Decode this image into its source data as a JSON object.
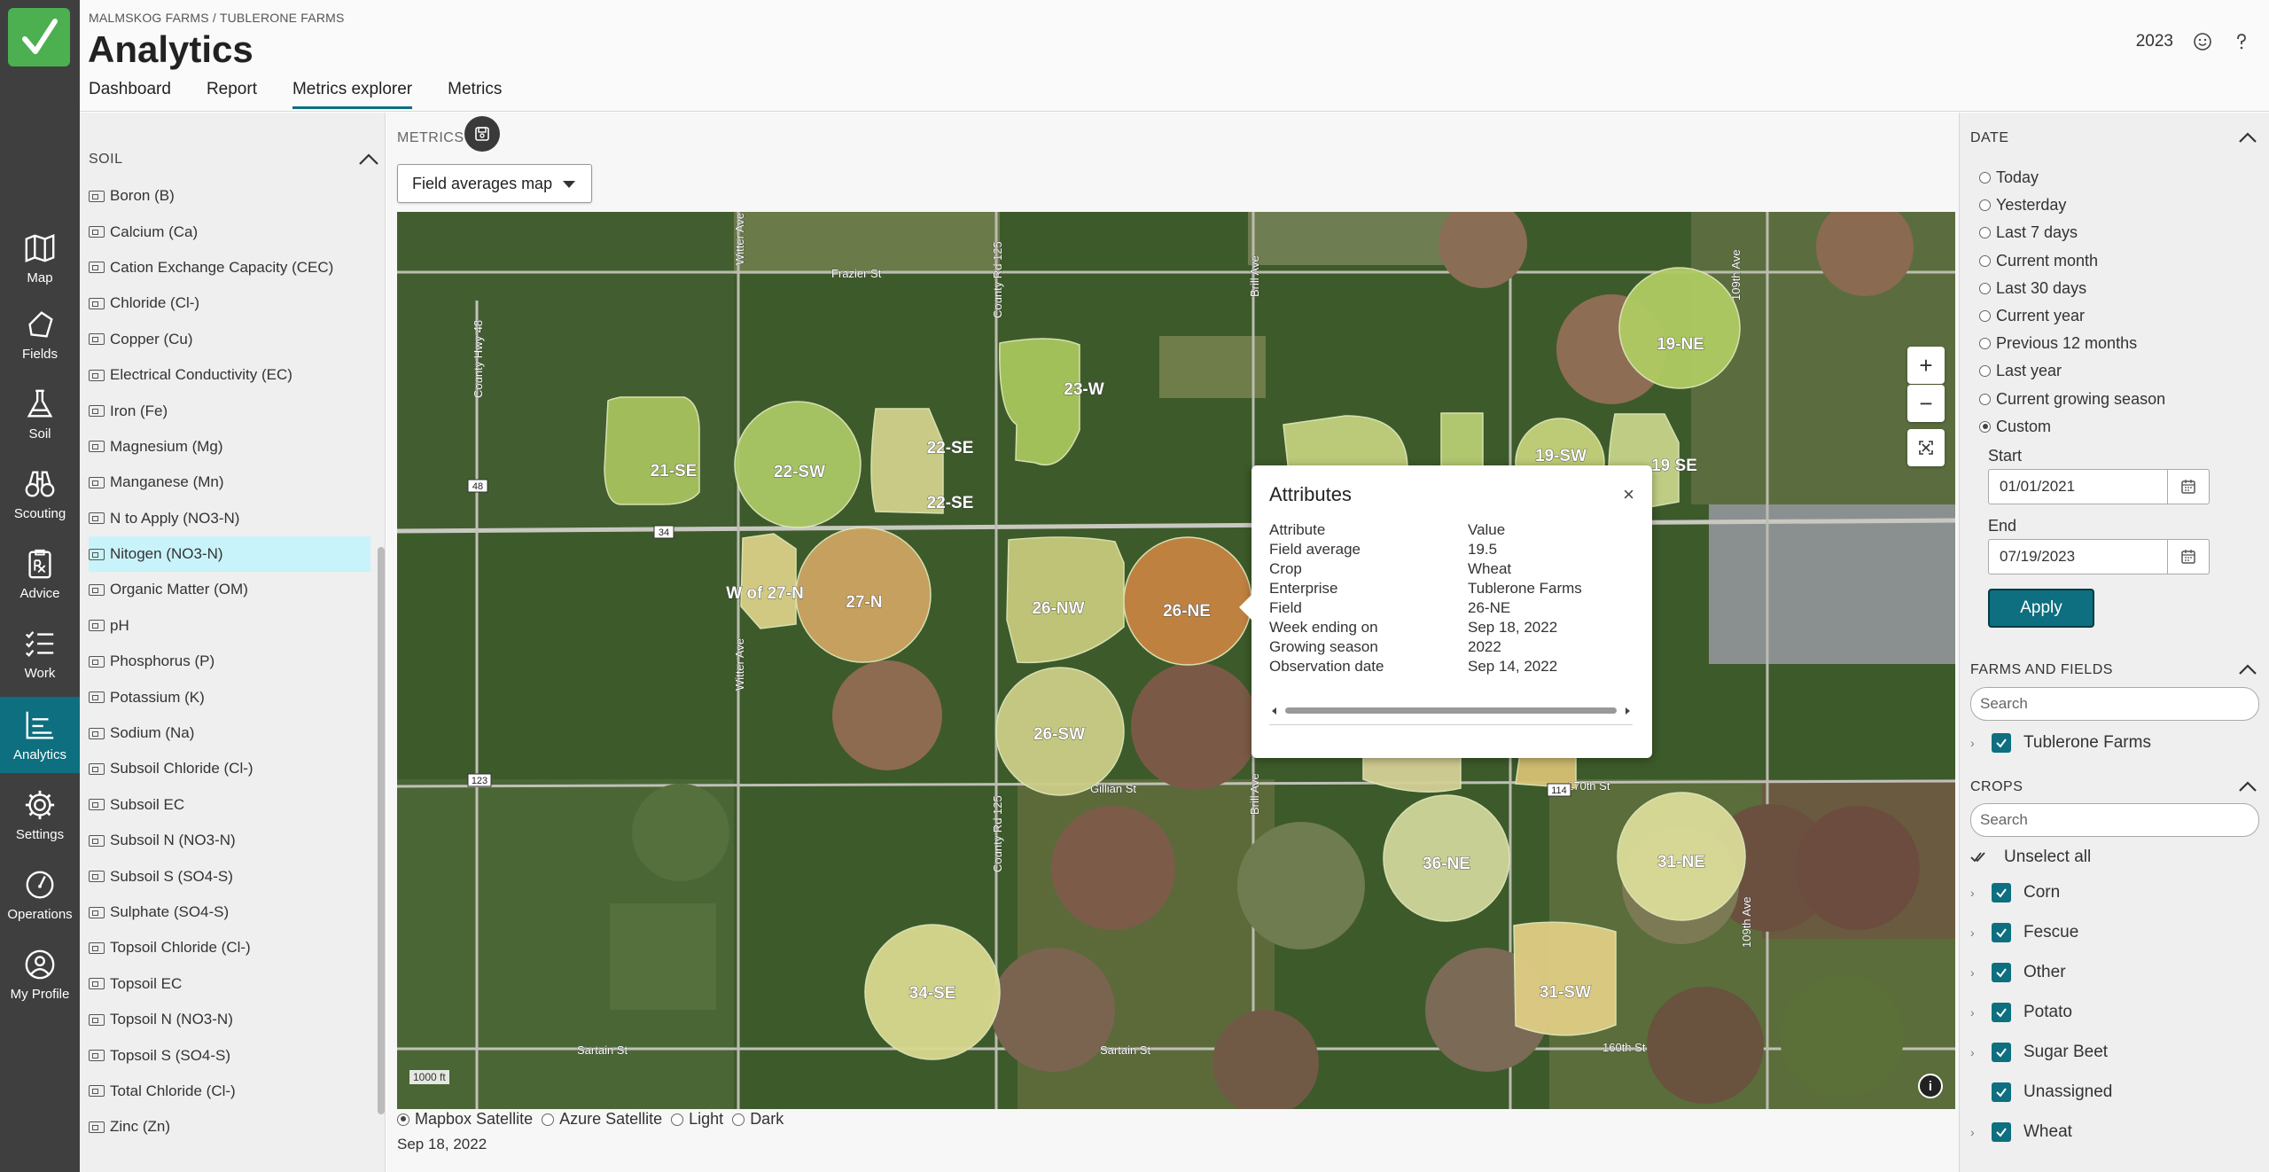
{
  "header": {
    "breadcrumb": "MALMSKOG FARMS / TUBLERONE FARMS",
    "title": "Analytics",
    "tabs": [
      "Dashboard",
      "Report",
      "Metrics explorer",
      "Metrics"
    ],
    "active_tab": "Metrics explorer",
    "year": "2023"
  },
  "nav": {
    "items": [
      {
        "label": "Map",
        "icon": "map-icon"
      },
      {
        "label": "Fields",
        "icon": "fields-icon"
      },
      {
        "label": "Soil",
        "icon": "flask-icon"
      },
      {
        "label": "Scouting",
        "icon": "binoculars-icon"
      },
      {
        "label": "Advice",
        "icon": "prescription-icon"
      },
      {
        "label": "Work",
        "icon": "checklist-icon"
      },
      {
        "label": "Analytics",
        "icon": "chart-icon"
      },
      {
        "label": "Settings",
        "icon": "gear-icon"
      },
      {
        "label": "Operations",
        "icon": "gauge-icon"
      },
      {
        "label": "My Profile",
        "icon": "user-icon"
      }
    ],
    "active": "Analytics"
  },
  "metrics_panel": {
    "section": "SOIL",
    "items": [
      "Boron (B)",
      "Calcium (Ca)",
      "Cation Exchange Capacity (CEC)",
      "Chloride (Cl-)",
      "Copper (Cu)",
      "Electrical Conductivity (EC)",
      "Iron (Fe)",
      "Magnesium (Mg)",
      "Manganese (Mn)",
      "N to Apply (NO3-N)",
      "Nitogen (NO3-N)",
      "Organic Matter (OM)",
      "pH",
      "Phosphorus (P)",
      "Potassium (K)",
      "Sodium (Na)",
      "Subsoil Chloride (Cl-)",
      "Subsoil EC",
      "Subsoil N (NO3-N)",
      "Subsoil S (SO4-S)",
      "Sulphate (SO4-S)",
      "Topsoil Chloride (Cl-)",
      "Topsoil EC",
      "Topsoil N (NO3-N)",
      "Topsoil S (SO4-S)",
      "Total Chloride (Cl-)",
      "Zinc (Zn)"
    ],
    "selected": "Nitogen (NO3-N)"
  },
  "center": {
    "metrics_label": "METRICS",
    "view_select": "Field averages map",
    "scale": "1000 ft",
    "basemaps": [
      "Mapbox Satellite",
      "Azure Satellite",
      "Light",
      "Dark"
    ],
    "basemap_selected": "Mapbox Satellite",
    "date": "Sep 18, 2022"
  },
  "map": {
    "roads": [
      "Frazier St",
      "Gillian St",
      "Sartain St",
      "Sartain St",
      "170th St",
      "160th St",
      "County Hwy 48",
      "Witter Ave",
      "Witter Ave",
      "County Rd 125",
      "County Rd 125",
      "Brill Ave",
      "Brill Ave",
      "109th Ave",
      "109th Ave"
    ],
    "shields": [
      "48",
      "34",
      "123",
      "114"
    ],
    "fields": [
      "21-SE",
      "22-SW",
      "22-SE",
      "22-SE",
      "23-W",
      "W of 27-N",
      "27-N",
      "26-NW",
      "26-NE",
      "26-SW",
      "19-NE",
      "19-SW",
      "19 SE",
      "36-NE",
      "31-NE",
      "31-SW",
      "34-SE"
    ]
  },
  "popup": {
    "title": "Attributes",
    "close": "×",
    "header": {
      "k": "Attribute",
      "v": "Value"
    },
    "rows": [
      {
        "k": "Field average",
        "v": "19.5"
      },
      {
        "k": "Crop",
        "v": "Wheat"
      },
      {
        "k": "Enterprise",
        "v": "Tublerone Farms"
      },
      {
        "k": "Field",
        "v": "26-NE"
      },
      {
        "k": "Week ending on",
        "v": "Sep 18, 2022"
      },
      {
        "k": "Growing season",
        "v": "2022"
      },
      {
        "k": "Observation date",
        "v": "Sep 14, 2022"
      }
    ]
  },
  "filters": {
    "date": {
      "title": "DATE",
      "options": [
        "Today",
        "Yesterday",
        "Last 7 days",
        "Current month",
        "Last 30 days",
        "Current year",
        "Previous 12 months",
        "Last year",
        "Current growing season",
        "Custom"
      ],
      "selected": "Custom",
      "start_label": "Start",
      "start": "01/01/2021",
      "end_label": "End",
      "end": "07/19/2023",
      "apply": "Apply"
    },
    "farms": {
      "title": "FARMS AND FIELDS",
      "placeholder": "Search",
      "items": [
        "Tublerone Farms"
      ]
    },
    "crops": {
      "title": "CROPS",
      "placeholder": "Search",
      "unselect_all": "Unselect all",
      "items": [
        "Corn",
        "Fescue",
        "Other",
        "Potato",
        "Sugar Beet",
        "Unassigned",
        "Wheat"
      ]
    }
  },
  "colors": {
    "accent": "#0d6f7f",
    "rail": "#3f3f3f",
    "highlight": "#c8f3fb"
  }
}
